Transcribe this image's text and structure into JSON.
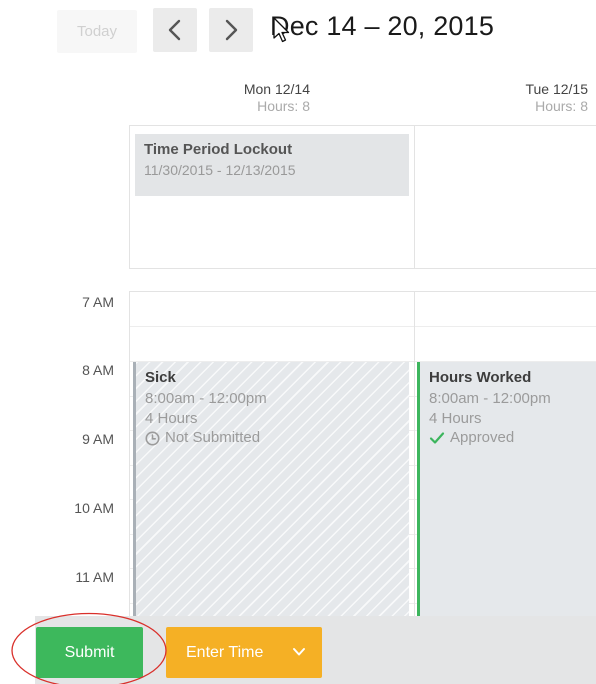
{
  "toolbar": {
    "today_label": "Today",
    "prev_icon": "chevron-left-icon",
    "next_icon": "chevron-right-icon",
    "date_range": "Dec 14 – 20, 2015"
  },
  "days": [
    {
      "name": "Mon 12/14",
      "hours": "Hours: 8"
    },
    {
      "name": "Tue 12/15",
      "hours": "Hours: 8"
    }
  ],
  "allday": {
    "lockout_title": "Time Period Lockout",
    "lockout_dates": "11/30/2015 - 12/13/2015"
  },
  "time_labels": [
    "7 AM",
    "8 AM",
    "9 AM",
    "10 AM",
    "11 AM"
  ],
  "events": {
    "sick": {
      "title": "Sick",
      "time": "8:00am - 12:00pm",
      "hours": "4 Hours",
      "status": "Not Submitted",
      "status_icon": "clock-icon"
    },
    "worked": {
      "title": "Hours Worked",
      "time": "8:00am - 12:00pm",
      "hours": "4 Hours",
      "status": "Approved",
      "status_icon": "check-icon"
    }
  },
  "actions": {
    "submit_label": "Submit",
    "enter_time_label": "Enter Time",
    "dropdown_icon": "chevron-down-icon"
  },
  "colors": {
    "submit": "#3db85c",
    "enter_time": "#f5b025",
    "approved": "#3cb55d",
    "annotation": "#d9302b"
  }
}
